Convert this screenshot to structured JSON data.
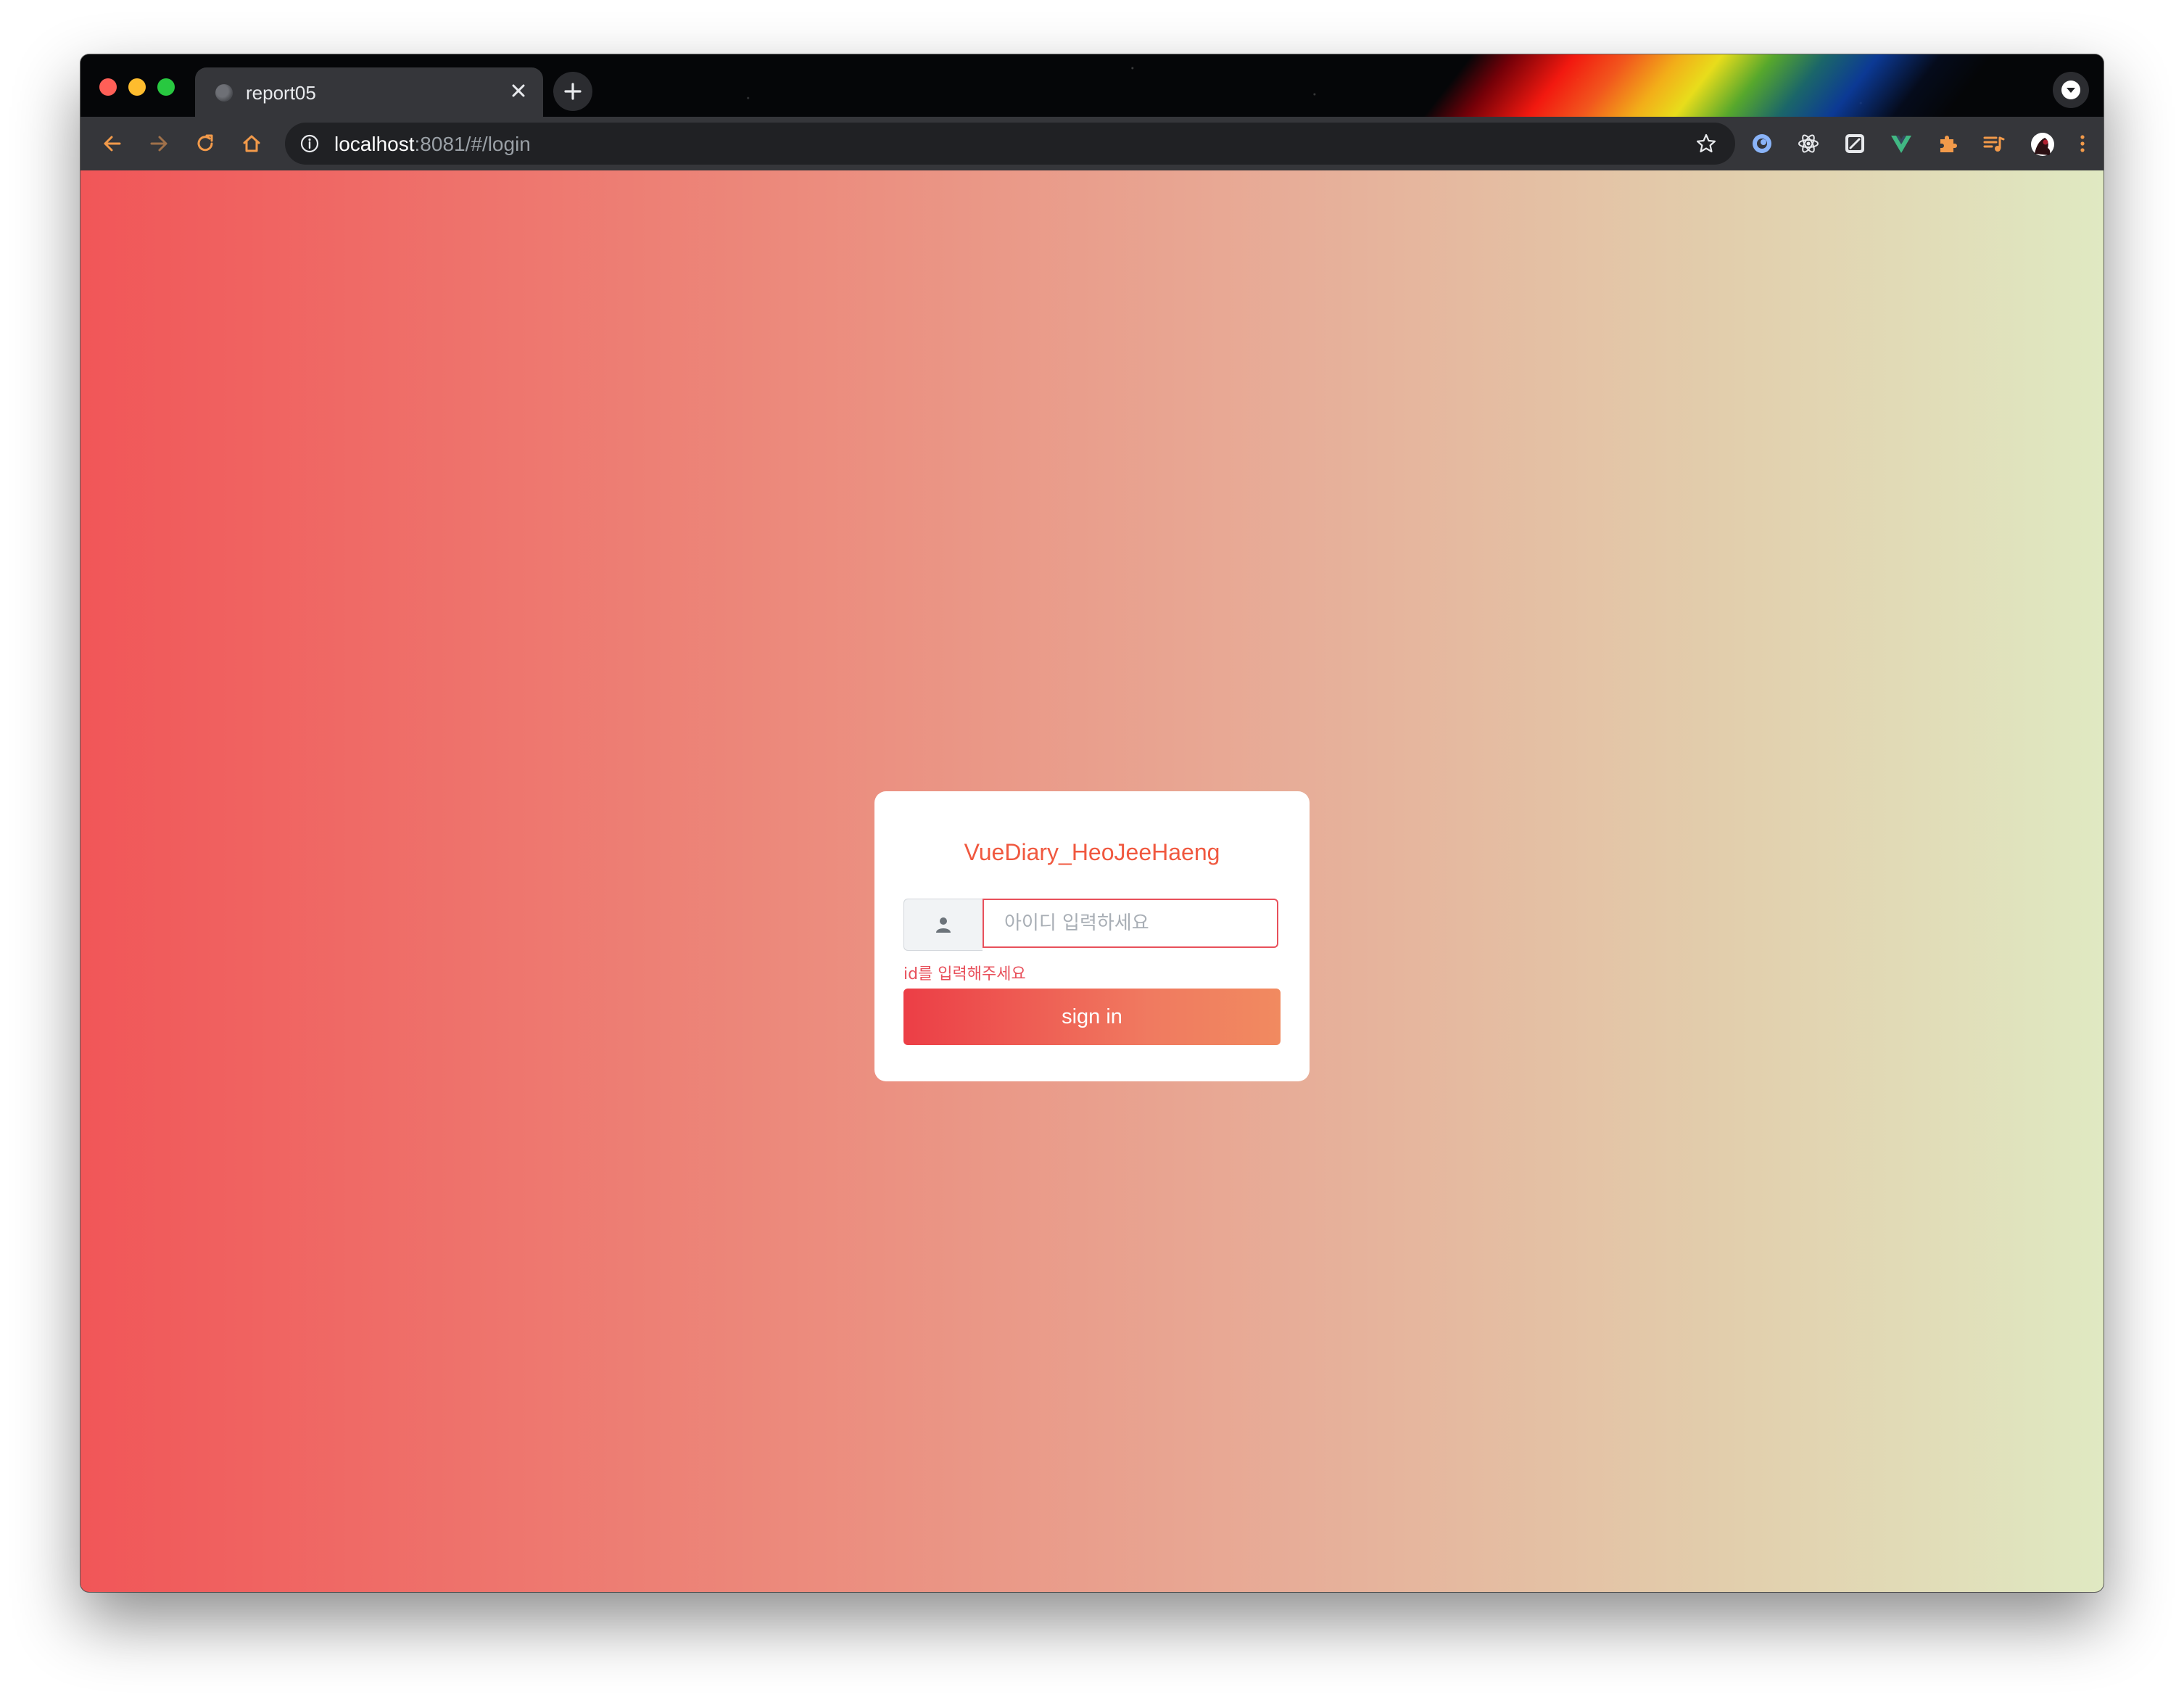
{
  "browser": {
    "tab": {
      "title": "report05"
    },
    "address_bar": {
      "host": "localhost",
      "path": ":8081/#/login"
    },
    "icons": {
      "back": "arrow-left-icon",
      "forward": "arrow-right-icon",
      "reload": "reload-icon",
      "home": "home-icon",
      "site_info": "info-icon",
      "bookmark": "star-icon",
      "extensions": [
        "extension-blue-icon",
        "react-devtools-icon",
        "edit-extension-icon",
        "vue-devtools-icon",
        "puzzle-extensions-icon",
        "media-queue-icon",
        "profile-avatar-icon",
        "more-menu-icon"
      ]
    },
    "colors": {
      "toolbar_accent": "#f29a4a"
    }
  },
  "login": {
    "title": "VueDiary_HeoJeeHaeng",
    "id_input": {
      "placeholder": "아이디 입력하세요",
      "value": ""
    },
    "error_message": "id를 입력해주세요",
    "submit_label": "sign in"
  },
  "colors": {
    "gradient_start": "#f15658",
    "gradient_end": "#e0e9c2",
    "accent": "#f0583f",
    "error": "#e8505b"
  }
}
